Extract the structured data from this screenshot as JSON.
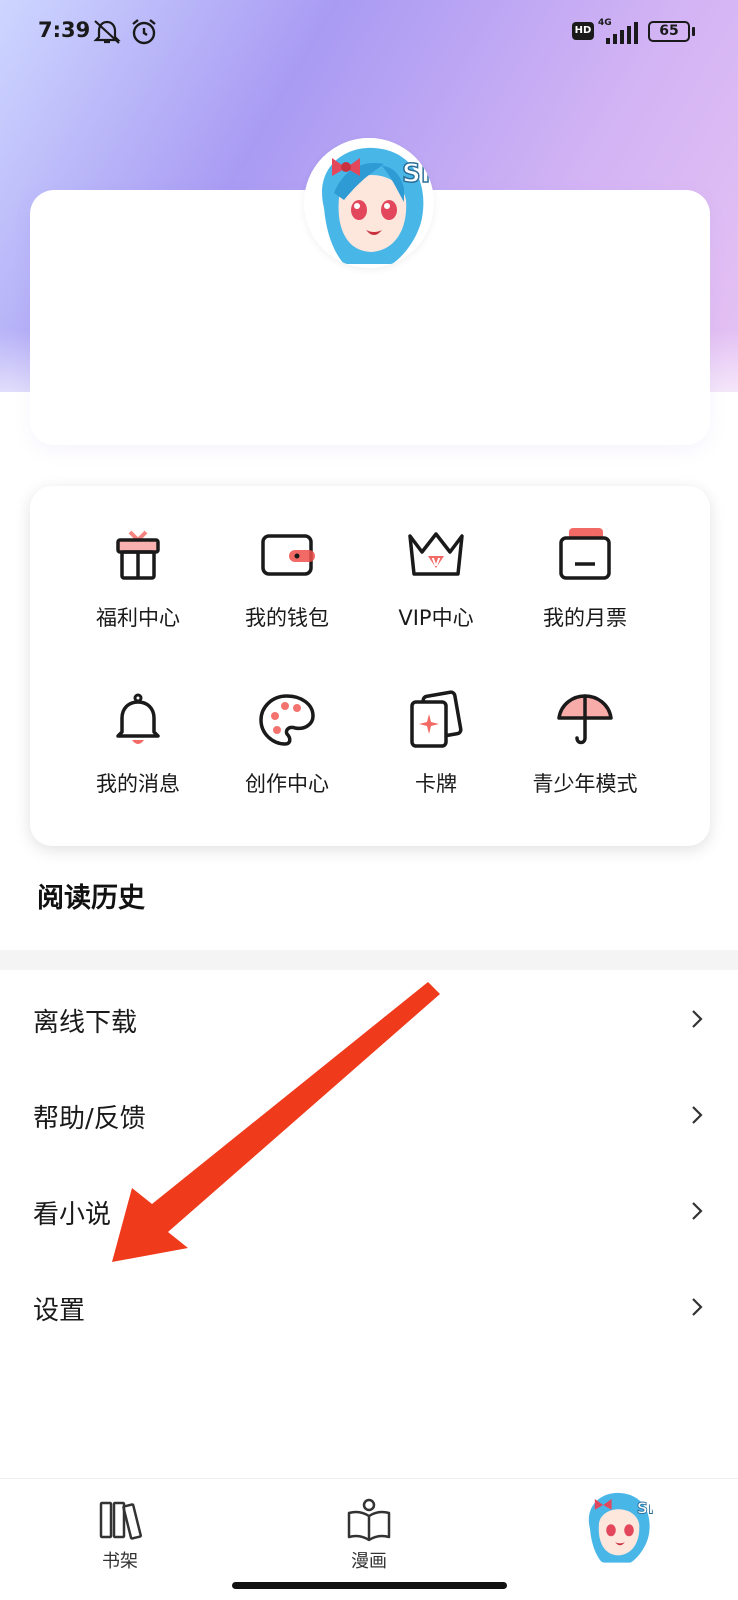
{
  "status_bar": {
    "time": "7:39",
    "hd": "HD",
    "network": "4G",
    "battery": "65"
  },
  "features": [
    {
      "label": "福利中心",
      "icon": "gift-icon"
    },
    {
      "label": "我的钱包",
      "icon": "wallet-icon"
    },
    {
      "label": "VIP中心",
      "icon": "crown-icon"
    },
    {
      "label": "我的月票",
      "icon": "ticket-icon"
    },
    {
      "label": "我的消息",
      "icon": "bell-icon"
    },
    {
      "label": "创作中心",
      "icon": "palette-icon"
    },
    {
      "label": "卡牌",
      "icon": "cards-icon"
    },
    {
      "label": "青少年模式",
      "icon": "umbrella-icon"
    }
  ],
  "history": {
    "title": "阅读历史"
  },
  "menu": [
    {
      "label": "离线下载"
    },
    {
      "label": "帮助/反馈"
    },
    {
      "label": "看小说"
    },
    {
      "label": "设置"
    }
  ],
  "bottom_nav": [
    {
      "label": "书架",
      "icon": "bookshelf-icon"
    },
    {
      "label": "漫画",
      "icon": "open-book-icon"
    },
    {
      "label": "",
      "icon": "profile-avatar"
    }
  ],
  "colors": {
    "accent": "#f0504a",
    "annotation_arrow": "#f03a1c"
  }
}
